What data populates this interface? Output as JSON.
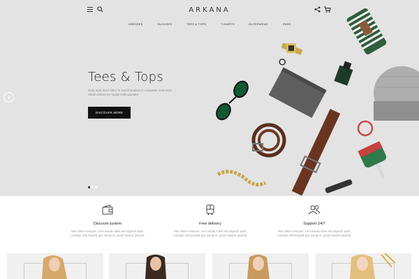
{
  "header": {
    "logo": "ARKANA",
    "icons": [
      "menu-icon",
      "search-icon",
      "share-icon",
      "cart-icon"
    ]
  },
  "nav": {
    "items": [
      "DRESSES",
      "BLOUSES",
      "TEES & TOPS",
      "T-SHIRTS",
      "OUTERWEAR",
      "PANS"
    ]
  },
  "hero": {
    "title": "Tees & Tops",
    "text": "Duis aute irure dolor in reprehenderit in voluptate velit esse cillum dolore eu fugiat nulla pariatur.",
    "button": "DISCOVER MORE",
    "slides_total": 3,
    "active_slide": 1
  },
  "features": [
    {
      "icon": "wallet-icon",
      "title": "Discount system",
      "text": "Nam libero tempore, cum soluta nobis est eligendi optio, cumque nihil impedit quo minus id, quod maxime placeat"
    },
    {
      "icon": "bus-icon",
      "title": "Free delivery",
      "text": "Nam libero tempore, cum soluta nobis est eligendi optio, cumque nihil impedit quo minus id, quod maxime placeat"
    },
    {
      "icon": "users-icon",
      "title": "Support 24/7",
      "text": "Nam libero tempore, cum soluta nobis est eligendi optio, cumque nihil impedit quo minus id, quod maxime placeat"
    }
  ],
  "colors": {
    "hero_bg": "#e3e3e3",
    "button_bg": "#111111",
    "text_muted": "#999999"
  }
}
